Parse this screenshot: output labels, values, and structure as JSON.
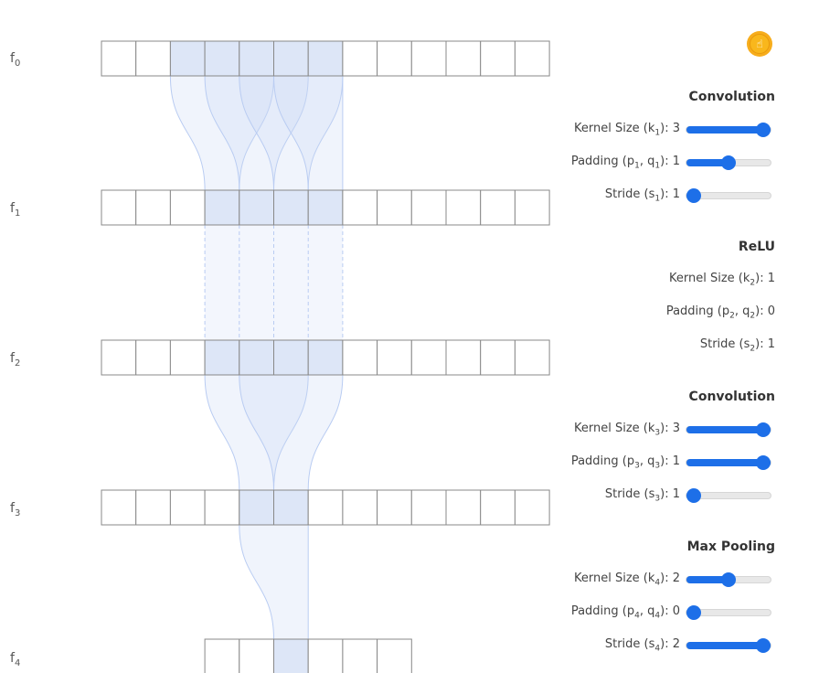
{
  "feature_labels": [
    {
      "base": "f",
      "sub": "0"
    },
    {
      "base": "f",
      "sub": "1"
    },
    {
      "base": "f",
      "sub": "2"
    },
    {
      "base": "f",
      "sub": "3"
    },
    {
      "base": "f",
      "sub": "4"
    }
  ],
  "layers": {
    "f0": {
      "cells": 13,
      "highlighted": [
        2,
        3,
        4,
        5,
        6
      ]
    },
    "f1": {
      "cells": 13,
      "highlighted": [
        3,
        4,
        5,
        6
      ]
    },
    "f2": {
      "cells": 13,
      "highlighted": [
        3,
        4,
        5,
        6
      ]
    },
    "f3": {
      "cells": 13,
      "highlighted": [
        4,
        5
      ]
    },
    "f4": {
      "cells": 6,
      "highlighted": [
        2
      ]
    }
  },
  "panel": {
    "sections": [
      {
        "title": "Convolution",
        "index": "1",
        "interactive": true,
        "kernel": {
          "value": "3",
          "level": 1.0
        },
        "padding": {
          "value": "1",
          "level": 0.5
        },
        "stride": {
          "value": "1",
          "level": 0.0
        }
      },
      {
        "title": "ReLU",
        "index": "2",
        "interactive": false,
        "kernel": {
          "value": "1"
        },
        "padding": {
          "value": "0"
        },
        "stride": {
          "value": "1"
        }
      },
      {
        "title": "Convolution",
        "index": "3",
        "interactive": true,
        "kernel": {
          "value": "3",
          "level": 1.0
        },
        "padding": {
          "value": "1",
          "level": 1.0
        },
        "stride": {
          "value": "1",
          "level": 0.0
        }
      },
      {
        "title": "Max Pooling",
        "index": "4",
        "interactive": true,
        "kernel": {
          "value": "2",
          "level": 0.5
        },
        "padding": {
          "value": "0",
          "level": 0.0
        },
        "stride": {
          "value": "2",
          "level": 1.0
        }
      }
    ]
  },
  "icons": {
    "reset": "hand-pointer-icon"
  },
  "colors": {
    "accent": "#1d6fe8",
    "highlight": "#dde6f7",
    "flow": "#c9d8f5",
    "button": "#f7ad1c"
  }
}
